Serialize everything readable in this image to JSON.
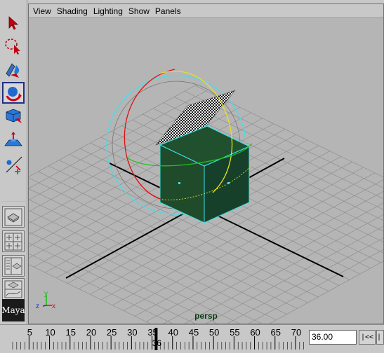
{
  "menubar": {
    "items": [
      "View",
      "Shading",
      "Lighting",
      "Show",
      "Panels"
    ]
  },
  "viewport": {
    "camera_label": "persp",
    "axis_labels": {
      "y": "y",
      "z": "z",
      "x": "x"
    }
  },
  "toolbox": {
    "tools": [
      {
        "name": "select-tool-icon"
      },
      {
        "name": "lasso-tool-icon"
      },
      {
        "name": "paint-select-tool-icon"
      },
      {
        "name": "rotate-tool-icon",
        "active": true
      },
      {
        "name": "scale-tool-icon"
      },
      {
        "name": "soft-mod-tool-icon"
      },
      {
        "name": "manipulator-tool-icon"
      }
    ],
    "logo": "Maya"
  },
  "timeslider": {
    "tick_labels": [
      "5",
      "10",
      "15",
      "20",
      "25",
      "30",
      "35",
      "40",
      "45",
      "50",
      "55",
      "60",
      "65",
      "70"
    ],
    "current_frame_marker": "36",
    "current_frame_value": "36.00",
    "goto_start_label": "|<<",
    "step_back_label": "|<"
  },
  "colors": {
    "viewport_bg": "#b5b5b5",
    "grid": "#8f8f8f",
    "cube_fill": "#1e4a2a",
    "wire_highlight": "#40e0e0"
  }
}
